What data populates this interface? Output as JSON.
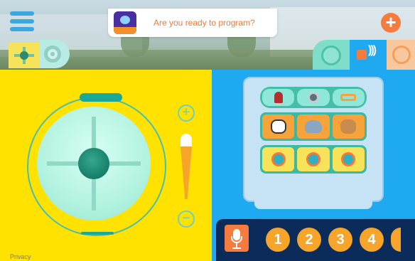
{
  "header": {
    "banner_text": "Are you ready to program?",
    "menu_icon": "hamburger-menu-icon",
    "add_icon": "plus-icon"
  },
  "tabs": {
    "left": [
      "drive-joystick-icon",
      "sensor-ring-icon"
    ],
    "right": [
      "disc-icon",
      "speaker-icon",
      "circle-icon"
    ]
  },
  "drive": {
    "speed_plus": "+",
    "speed_minus": "−"
  },
  "robot_panel": {
    "rows": [
      [
        "light-icon",
        "cd-icon",
        "horn-icon"
      ],
      [
        "cow-icon",
        "elephant-icon",
        "dog-icon"
      ],
      [
        "eye-icon",
        "eye-icon",
        "eye-icon"
      ]
    ]
  },
  "bottom_bar": {
    "mic_icon": "microphone-icon",
    "numbers": [
      "1",
      "2",
      "3",
      "4"
    ]
  },
  "footer": {
    "privacy": "Privacy"
  },
  "colors": {
    "yellow_panel": "#ffe200",
    "blue_panel": "#1ea9f0",
    "accent_orange": "#f57c3e",
    "teal": "#1aa89a",
    "navy": "#0b2c5b"
  }
}
